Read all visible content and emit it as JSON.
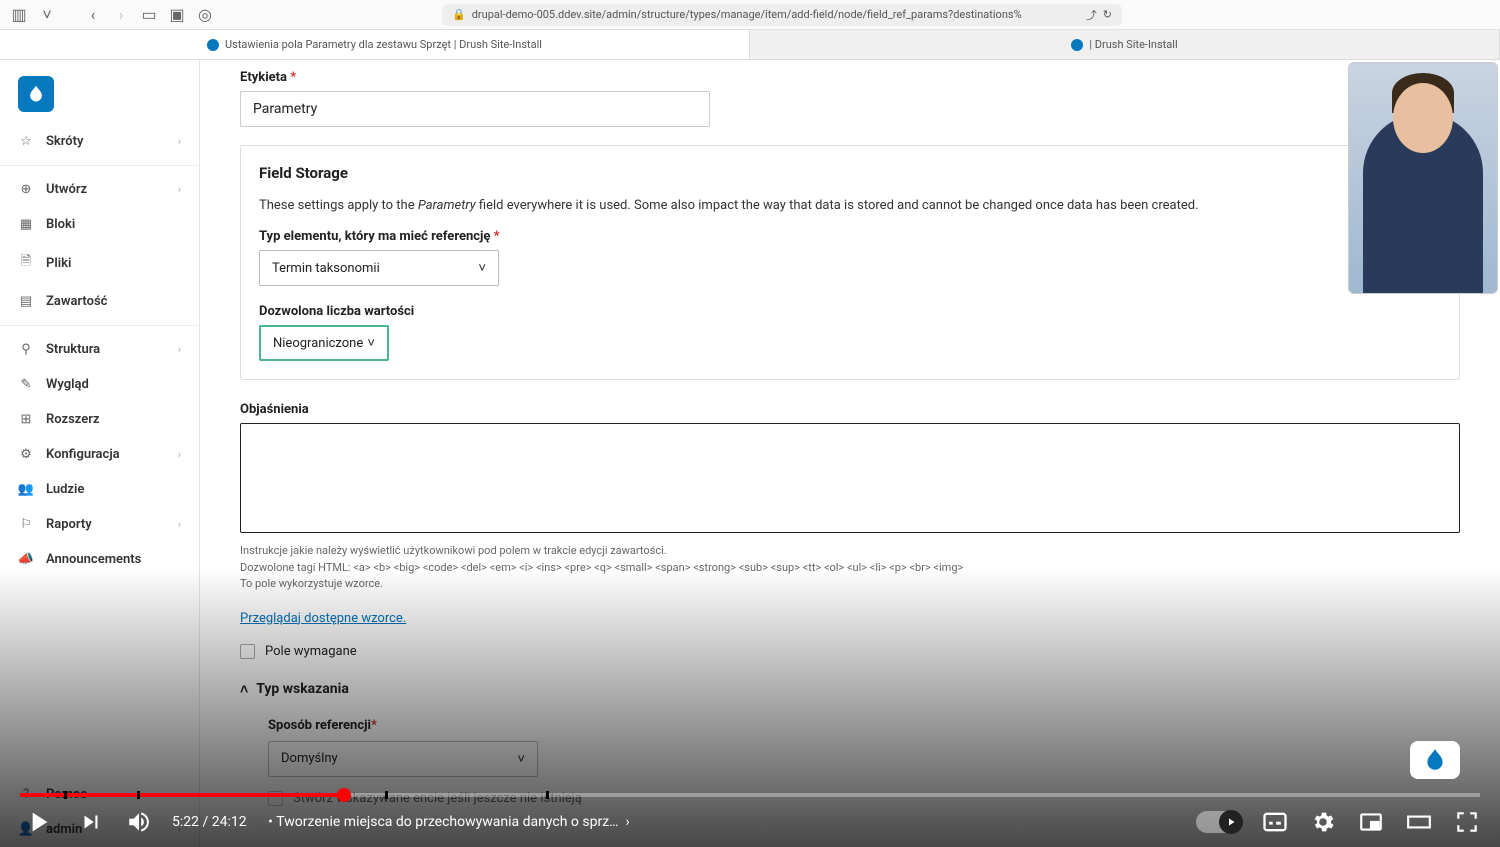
{
  "browser": {
    "url": "drupal-demo-005.ddev.site/admin/structure/types/manage/item/add-field/node/field_ref_params?destinations%"
  },
  "tabs": [
    {
      "label": "Ustawienia pola Parametry dla zestawu Sprzęt | Drush Site-Install",
      "active": true
    },
    {
      "label": "| Drush Site-Install",
      "active": false
    }
  ],
  "sidebar": {
    "top": [
      {
        "icon": "star",
        "label": "Skróty",
        "chev": true
      },
      {
        "_sep": true
      },
      {
        "icon": "plus-circle",
        "label": "Utwórz",
        "chev": true
      },
      {
        "icon": "grid",
        "label": "Bloki"
      },
      {
        "icon": "file",
        "label": "Pliki"
      },
      {
        "icon": "list",
        "label": "Zawartość"
      },
      {
        "_sep": true
      },
      {
        "icon": "sliders",
        "label": "Struktura",
        "chev": true
      },
      {
        "icon": "brush",
        "label": "Wygląd"
      },
      {
        "icon": "puzzle",
        "label": "Rozszerz"
      },
      {
        "icon": "settings",
        "label": "Konfiguracja",
        "chev": true
      },
      {
        "icon": "users",
        "label": "Ludzie"
      },
      {
        "icon": "flag",
        "label": "Raporty",
        "chev": true
      },
      {
        "icon": "megaphone",
        "label": "Announcements"
      }
    ],
    "bottom": [
      {
        "icon": "help",
        "label": "Pomoc"
      },
      {
        "icon": "user",
        "label": "admin",
        "chev": true
      }
    ]
  },
  "form": {
    "label_field": {
      "label": "Etykieta",
      "value": "Parametry"
    },
    "storage": {
      "title": "Field Storage",
      "desc_pre": "These settings apply to the ",
      "desc_em": "Parametry",
      "desc_post": " field everywhere it is used. Some also impact the way that data is stored and cannot be changed once data has been created.",
      "ref_type": {
        "label": "Typ elementu, który ma mieć referencję",
        "value": "Termin taksonomii"
      },
      "allowed": {
        "label": "Dozwolona liczba wartości",
        "value": "Nieograniczone"
      }
    },
    "explanation": {
      "label": "Objaśnienia",
      "value": "",
      "help1": "Instrukcje jakie należy wyświetlić użytkownikowi pod polem w trakcie edycji zawartości.",
      "help2": "Dozwolone tagi HTML: <a> <b> <big> <code> <del> <em> <i> <ins> <pre> <q> <small> <span> <strong> <sub> <sup> <tt> <ol> <ul> <li> <p> <br> <img>",
      "help3": "To pole wykorzystuje wzorce.",
      "link": "Przeglądaj dostępne wzorce."
    },
    "required": {
      "label": "Pole wymagane",
      "checked": false
    },
    "ref_section": {
      "title": "Typ wskazania",
      "method": {
        "label": "Sposób referencji",
        "value": "Domyślny"
      },
      "create_label": "Stwórz wskazywane encie jeśli jeszcze nie istnieją"
    }
  },
  "player": {
    "current": "5:22",
    "duration": "24:12",
    "progress_pct": 22.2,
    "chapter": "Tworzenie miejsca do przechowywania danych o sprz…",
    "chapter_ticks": [
      3,
      8,
      25,
      36
    ]
  }
}
